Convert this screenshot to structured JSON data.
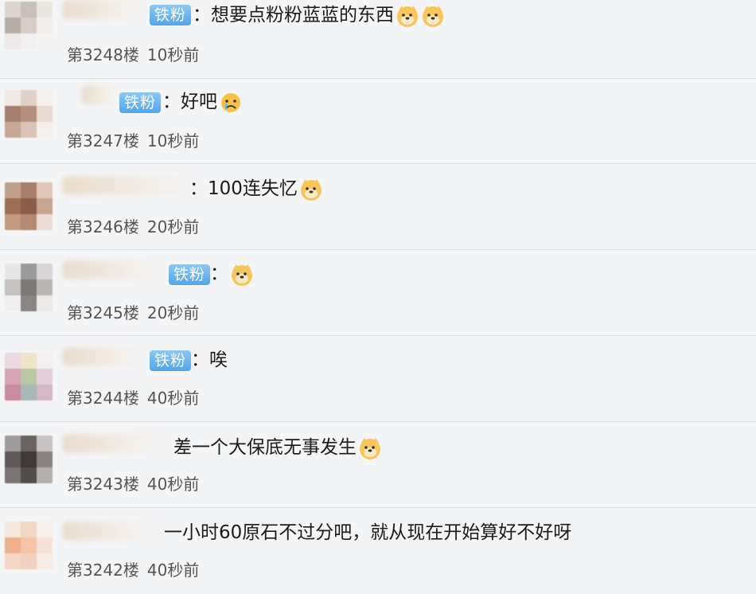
{
  "comments": [
    {
      "badge": "铁粉",
      "text": "：想要点粉粉蓝蓝的东西",
      "emojis": [
        "doge-emoji",
        "doge-emoji"
      ],
      "floor": "第3248楼",
      "time": "10秒前"
    },
    {
      "badge": "铁粉",
      "text": "：好吧",
      "emojis": [
        "sad-face-emoji"
      ],
      "floor": "第3247楼",
      "time": "10秒前"
    },
    {
      "badge": "",
      "text": "：100连失忆",
      "emojis": [
        "doge-emoji"
      ],
      "floor": "第3246楼",
      "time": "20秒前"
    },
    {
      "badge": "铁粉",
      "text": "：",
      "emojis": [
        "doge-emoji"
      ],
      "floor": "第3245楼",
      "time": "20秒前"
    },
    {
      "badge": "铁粉",
      "text": "：唉",
      "emojis": [],
      "floor": "第3244楼",
      "time": "40秒前"
    },
    {
      "badge": "",
      "text": "差一个大保底无事发生",
      "emojis": [
        "doge-emoji"
      ],
      "floor": "第3243楼",
      "time": "40秒前"
    },
    {
      "badge": "",
      "text": "一小时60原石不过分吧，就从现在开始算好不好呀",
      "emojis": [],
      "floor": "第3242楼",
      "time": "40秒前"
    }
  ]
}
